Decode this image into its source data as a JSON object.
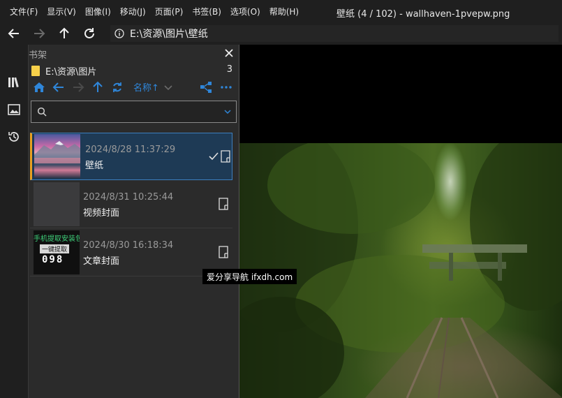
{
  "menu": {
    "items": [
      "文件(F)",
      "显示(V)",
      "图像(I)",
      "移动(J)",
      "页面(P)",
      "书签(B)",
      "选项(O)",
      "帮助(H)"
    ]
  },
  "window": {
    "title": "壁纸 (4 / 102) - wallhaven-1pvepw.png"
  },
  "address": {
    "path": "E:\\资源\\图片\\壁纸"
  },
  "panel": {
    "title": "书架",
    "folder_path": "E:\\资源\\图片",
    "count": "3",
    "sort_label": "名称↑",
    "search_placeholder": ""
  },
  "items": [
    {
      "date": "2024/8/28 11:37:29",
      "name": "壁纸",
      "selected": true,
      "checked": true
    },
    {
      "date": "2024/8/31 10:25:44",
      "name": "视频封面",
      "selected": false,
      "checked": false
    },
    {
      "date": "2024/8/30 16:18:34",
      "name": "文章封面",
      "selected": false,
      "checked": false
    }
  ],
  "thumb3_text": {
    "line1": "手机提取安装包",
    "line2": "一键提取",
    "line3": "098"
  },
  "tooltip": "爱分享导航 ifxdh.com",
  "colors": {
    "accent": "#2f86d9",
    "selected_bg": "#1e3a55",
    "folder": "#f7d04a",
    "marker": "#e8a020"
  }
}
